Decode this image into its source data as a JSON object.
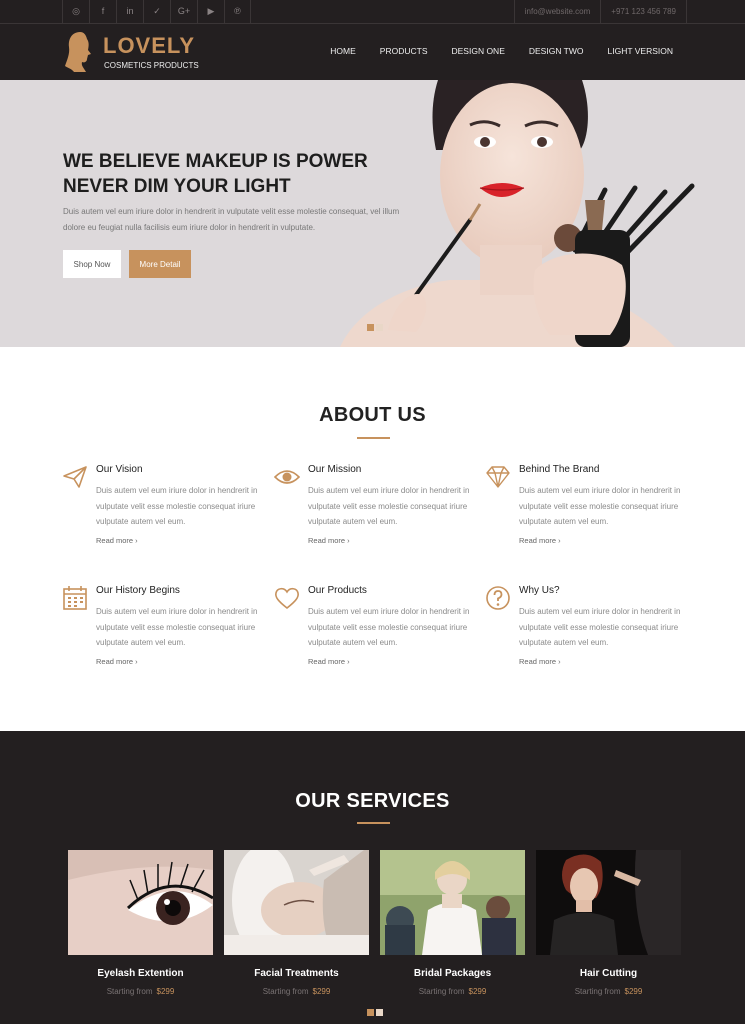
{
  "topbar": {
    "social_icons": [
      "instagram-icon",
      "facebook-icon",
      "linkedin-icon",
      "twitter-icon",
      "google-plus-icon",
      "youtube-icon",
      "pinterest-icon"
    ],
    "social_glyphs": [
      "◎",
      "f",
      "in",
      "✓",
      "G+",
      "▶",
      "℗"
    ],
    "email": "info@website.com",
    "phone": "+971 123 456 789"
  },
  "header": {
    "brand": "LOVELY",
    "tagline": "COSMETICS PRODUCTS",
    "menu": [
      "HOME",
      "PRODUCTS",
      "DESIGN ONE",
      "DESIGN TWO",
      "LIGHT VERSION"
    ]
  },
  "hero": {
    "title_line1": "WE BELIEVE MAKEUP IS POWER",
    "title_line2": "NEVER DIM YOUR LIGHT",
    "text": "Duis autem vel eum iriure dolor in hendrerit in vulputate velit esse molestie consequat, vel illum dolore eu feugiat nulla facilisis eum iriure dolor in hendrerit in vulputate.",
    "btn_shop": "Shop Now",
    "btn_more": "More Detail"
  },
  "about": {
    "title": "ABOUT US",
    "items": [
      {
        "title": "Our Vision",
        "icon": "paper-plane-icon",
        "text": "Duis autem vel eum iriure dolor in hendrerit in vulputate velit esse molestie consequat iriure vulputate autem vel eum.",
        "link": "Read more ›"
      },
      {
        "title": "Our Mission",
        "icon": "eye-icon",
        "text": "Duis autem vel eum iriure dolor in hendrerit in vulputate velit esse molestie consequat iriure vulputate autem vel eum.",
        "link": "Read more ›"
      },
      {
        "title": "Behind The Brand",
        "icon": "diamond-icon",
        "text": "Duis autem vel eum iriure dolor in hendrerit in vulputate velit esse molestie consequat iriure vulputate autem vel eum.",
        "link": "Read more ›"
      },
      {
        "title": "Our History Begins",
        "icon": "calendar-icon",
        "text": "Duis autem vel eum iriure dolor in hendrerit in vulputate velit esse molestie consequat iriure vulputate autem vel eum.",
        "link": "Read more ›"
      },
      {
        "title": "Our Products",
        "icon": "heart-icon",
        "text": "Duis autem vel eum iriure dolor in hendrerit in vulputate velit esse molestie consequat iriure vulputate autem vel eum.",
        "link": "Read more ›"
      },
      {
        "title": "Why Us?",
        "icon": "question-icon",
        "text": "Duis autem vel eum iriure dolor in hendrerit in vulputate velit esse molestie consequat iriure vulputate autem vel eum.",
        "link": "Read more ›"
      }
    ]
  },
  "services": {
    "title": "OUR SERVICES",
    "price_label": "Starting from",
    "items": [
      {
        "name": "Eyelash Extention",
        "price": "$299"
      },
      {
        "name": "Facial Treatments",
        "price": "$299"
      },
      {
        "name": "Bridal Packages",
        "price": "$299"
      },
      {
        "name": "Hair Cutting",
        "price": "$299"
      }
    ]
  },
  "colors": {
    "accent": "#c7925d",
    "dark": "#231f20",
    "hero_bg": "#ddd9db"
  }
}
